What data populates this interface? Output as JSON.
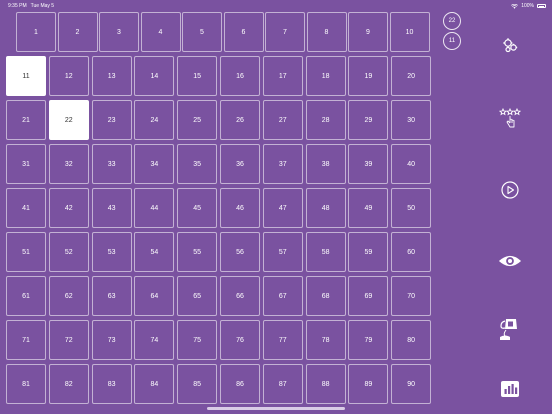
{
  "status_bar": {
    "time": "9:35 PM",
    "day": "Tue May 5",
    "battery": "100%"
  },
  "grid": {
    "numbers": [
      1,
      2,
      3,
      4,
      5,
      6,
      7,
      8,
      9,
      10,
      11,
      12,
      13,
      14,
      15,
      16,
      17,
      18,
      19,
      20,
      21,
      22,
      23,
      24,
      25,
      26,
      27,
      28,
      29,
      30,
      31,
      32,
      33,
      34,
      35,
      36,
      37,
      38,
      39,
      40,
      41,
      42,
      43,
      44,
      45,
      46,
      47,
      48,
      49,
      50,
      51,
      52,
      53,
      54,
      55,
      56,
      57,
      58,
      59,
      60,
      61,
      62,
      63,
      64,
      65,
      66,
      67,
      68,
      69,
      70,
      71,
      72,
      73,
      74,
      75,
      76,
      77,
      78,
      79,
      80,
      81,
      82,
      83,
      84,
      85,
      86,
      87,
      88,
      89,
      90
    ],
    "selected": [
      11,
      22
    ]
  },
  "recent_calls": [
    "22",
    "11"
  ],
  "side_icons": [
    "settings-gears-icon",
    "tap-stars-icon",
    "play-icon",
    "eye-icon",
    "pour-icon",
    "chart-icon"
  ],
  "colors": {
    "background": "#7a52a0",
    "selected_cell": "#ffffff",
    "cell_border": "#ffffff"
  }
}
